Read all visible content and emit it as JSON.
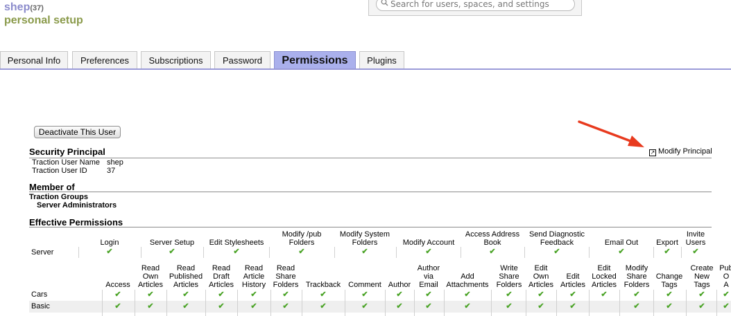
{
  "header": {
    "username": "shep",
    "count": "(37)",
    "subtitle": "personal setup"
  },
  "search": {
    "placeholder": "Search for users, spaces, and settings",
    "icon": "magnifier"
  },
  "tabs": [
    {
      "label": "Personal Info"
    },
    {
      "label": "Preferences"
    },
    {
      "label": "Subscriptions"
    },
    {
      "label": "Password"
    },
    {
      "label": "Permissions",
      "active": true
    },
    {
      "label": "Plugins"
    }
  ],
  "deactivate_label": "Deactivate This User",
  "security": {
    "title": "Security Principal",
    "modify_label": "Modify Principal",
    "rows": [
      {
        "key": "Traction User Name",
        "value": "shep"
      },
      {
        "key": "Traction User ID",
        "value": "37"
      }
    ]
  },
  "member": {
    "title": "Member of",
    "group_heading": "Traction Groups",
    "group": "Server Administrators"
  },
  "effective": {
    "title": "Effective Permissions",
    "server_label": "Server",
    "server_headers": [
      "Login",
      "Server Setup",
      "Edit Stylesheets",
      "Modify /pub\nFolders",
      "Modify System\nFolders",
      "Modify Account",
      "Access Address\nBook",
      "Send Diagnostic\nFeedback",
      "Email Out",
      "Export",
      "Invite\nUsers"
    ],
    "space_headers": [
      "Access",
      "Read\nOwn\nArticles",
      "Read\nPublished\nArticles",
      "Read\nDraft\nArticles",
      "Read\nArticle\nHistory",
      "Read\nShare\nFolders",
      "Trackback",
      "Comment",
      "Author",
      "Author\nvia\nEmail",
      "Add\nAttachments",
      "Write\nShare\nFolders",
      "Edit\nOwn\nArticles",
      "Edit\nArticles",
      "Edit\nLocked\nArticles",
      "Modify\nShare\nFolders",
      "Change\nTags",
      "Create\nNew\nTags",
      "Pub\nO\nA"
    ],
    "spaces": [
      {
        "name": "Cars",
        "checks": [
          true,
          true,
          true,
          true,
          true,
          true,
          true,
          true,
          true,
          true,
          true,
          true,
          true,
          true,
          true,
          true,
          true,
          true,
          true
        ]
      },
      {
        "name": "Basic",
        "checks": [
          true,
          true,
          true,
          true,
          true,
          true,
          true,
          true,
          true,
          true,
          true,
          true,
          true,
          true,
          false,
          true,
          true,
          true,
          true
        ]
      }
    ],
    "check_color": "#4aa326"
  },
  "colors": {
    "tab_active": "#aab0ec",
    "username": "#8c8ccc",
    "subtitle": "#8a9a4a",
    "arrow": "#e83a1e"
  }
}
